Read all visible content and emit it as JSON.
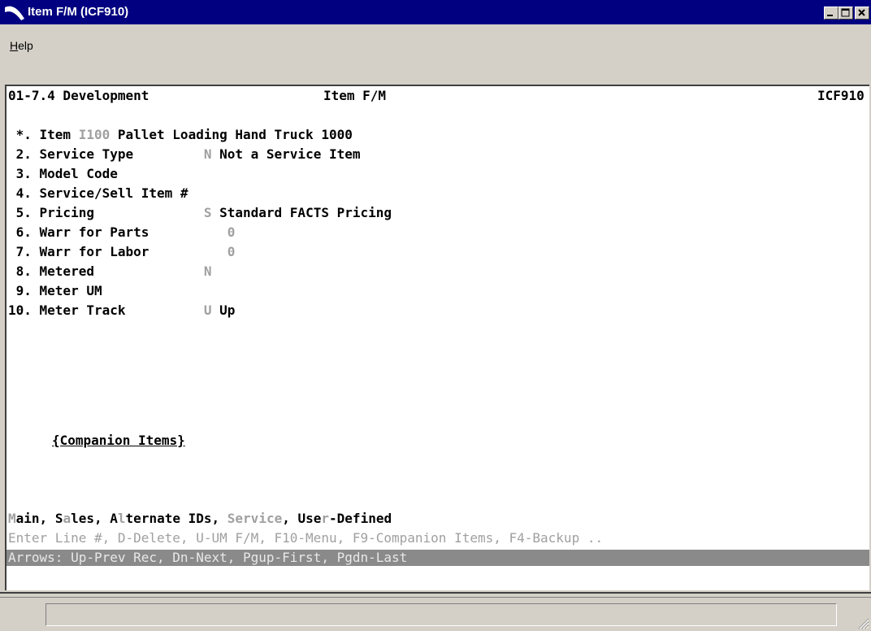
{
  "window": {
    "title": "Item F/M (ICF910)"
  },
  "menu": {
    "help_first": "H",
    "help_rest": "elp"
  },
  "screen": {
    "header_left": "01-7.4 Development",
    "header_center": "Item F/M",
    "header_right": "ICF910",
    "fields": [
      {
        "label": " *. Item ",
        "code": "I100",
        "value": " Pallet Loading Hand Truck 1000"
      },
      {
        "label": " 2. Service Type         ",
        "code": "N",
        "value": " Not a Service Item"
      },
      {
        "label": " 3. Model Code",
        "code": "",
        "value": ""
      },
      {
        "label": " 4. Service/Sell Item #",
        "code": "",
        "value": ""
      },
      {
        "label": " 5. Pricing              ",
        "code": "S",
        "value": " Standard FACTS Pricing"
      },
      {
        "label": " 6. Warr for Parts          ",
        "code": "0",
        "value": ""
      },
      {
        "label": " 7. Warr for Labor          ",
        "code": "0",
        "value": ""
      },
      {
        "label": " 8. Metered              ",
        "code": "N",
        "value": ""
      },
      {
        "label": " 9. Meter UM",
        "code": "",
        "value": ""
      },
      {
        "label": "10. Meter Track          ",
        "code": "U",
        "value": " Up"
      }
    ],
    "companion_link": "{Companion Items}",
    "tabs": {
      "main_a": "M",
      "main_b": "ain",
      "sep1": ", ",
      "sales_a": "S",
      "sales_b": "a",
      "sales_c": "les",
      "sep2": ", ",
      "alt_a": "A",
      "alt_b": "l",
      "alt_c": "ternate IDs",
      "sep3": ", ",
      "service": "Service",
      "sep4": ", ",
      "user_a": "Use",
      "user_b": "r",
      "user_c": "-Defined"
    },
    "prompt_line": "Enter Line #, D-Delete, U-UM F/M, F10-Menu, F9-Companion Items, F4-Backup ..",
    "nav_line": "Arrows: Up-Prev Rec, Dn-Next, Pgup-First, Pgdn-Last"
  },
  "status": {
    "text": ""
  }
}
